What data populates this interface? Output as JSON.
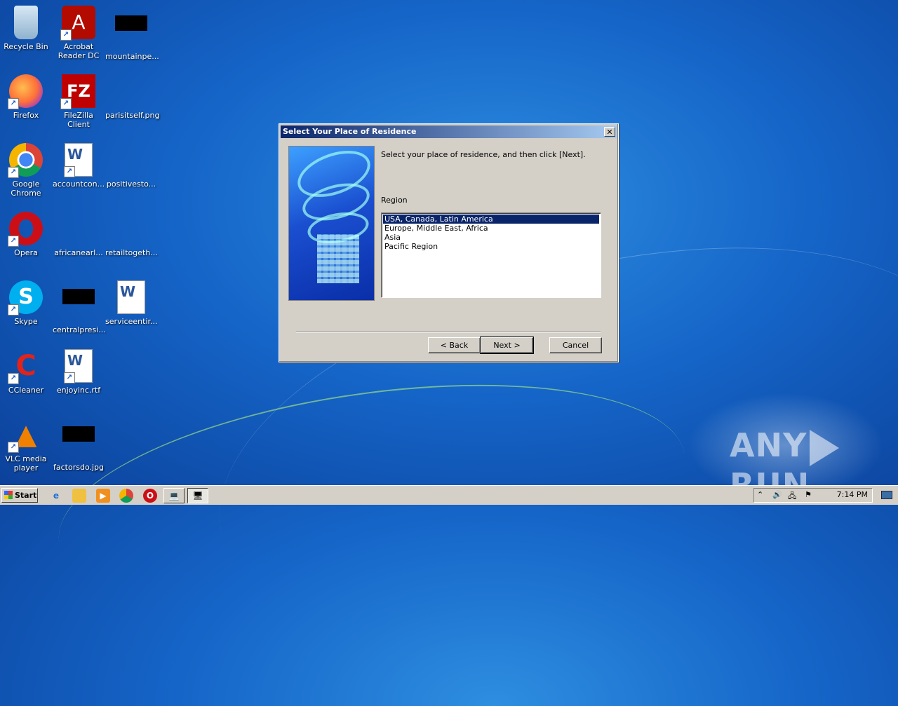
{
  "desktop": {
    "icons": [
      {
        "label": "Recycle Bin",
        "glyph": "🗑",
        "icon": "recycle-bin-icon"
      },
      {
        "label": "Acrobat Reader DC",
        "glyph": "A",
        "icon": "acrobat-icon"
      },
      {
        "label": "mountainpe...",
        "glyph": "",
        "icon": "file-thumbnail-icon"
      },
      {
        "label": "Firefox",
        "glyph": "🦊",
        "icon": "firefox-icon"
      },
      {
        "label": "FileZilla Client",
        "glyph": "FZ",
        "icon": "filezilla-icon"
      },
      {
        "label": "parisitself.png",
        "glyph": "",
        "icon": "png-file-icon"
      },
      {
        "label": "Google Chrome",
        "glyph": "◉",
        "icon": "chrome-icon"
      },
      {
        "label": "accountcon...",
        "glyph": "W",
        "icon": "word-doc-icon"
      },
      {
        "label": "positivesto...",
        "glyph": "",
        "icon": "file-thumbnail-icon"
      },
      {
        "label": "Opera",
        "glyph": "O",
        "icon": "opera-icon"
      },
      {
        "label": "africanearl...",
        "glyph": "",
        "icon": "file-thumbnail-icon"
      },
      {
        "label": "retailtogeth...",
        "glyph": "",
        "icon": "file-thumbnail-icon"
      },
      {
        "label": "Skype",
        "glyph": "S",
        "icon": "skype-icon"
      },
      {
        "label": "centralpresi...",
        "glyph": "",
        "icon": "file-thumbnail-icon"
      },
      {
        "label": "serviceentir...",
        "glyph": "W",
        "icon": "word-doc-icon"
      },
      {
        "label": "CCleaner",
        "glyph": "C",
        "icon": "ccleaner-icon"
      },
      {
        "label": "enjoyinc.rtf",
        "glyph": "W",
        "icon": "word-doc-icon"
      },
      {
        "label": "VLC media player",
        "glyph": "▲",
        "icon": "vlc-icon"
      },
      {
        "label": "factorsdo.jpg",
        "glyph": "",
        "icon": "jpg-file-icon"
      }
    ]
  },
  "dialog": {
    "title": "Select Your Place of Residence",
    "close_glyph": "✕",
    "instruction": "Select your place of residence, and then click [Next].",
    "region_label": "Region",
    "regions": [
      "USA, Canada, Latin America",
      "Europe, Middle East, Africa",
      "Asia",
      "Pacific Region"
    ],
    "selected_region": "USA, Canada, Latin America",
    "back_label": "< Back",
    "next_label": "Next >",
    "cancel_label": "Cancel"
  },
  "taskbar": {
    "start_label": "Start",
    "clock": "7:14 PM"
  },
  "watermark": {
    "left": "ANY",
    "right": "RUN"
  }
}
